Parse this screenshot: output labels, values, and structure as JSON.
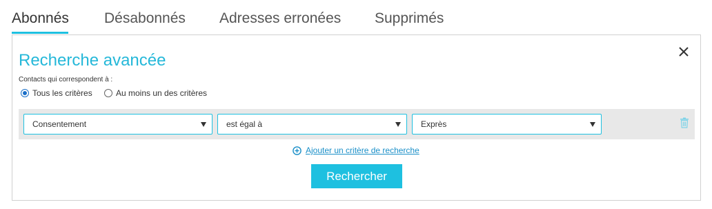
{
  "tabs": [
    {
      "label": "Abonnés",
      "active": true
    },
    {
      "label": "Désabonnés",
      "active": false
    },
    {
      "label": "Adresses erronées",
      "active": false
    },
    {
      "label": "Supprimés",
      "active": false
    }
  ],
  "search": {
    "title": "Recherche avancée",
    "match_label": "Contacts qui correspondent à :",
    "match_options": [
      {
        "label": "Tous les critères",
        "selected": true
      },
      {
        "label": "Au moins un des critères",
        "selected": false
      }
    ],
    "criteria": [
      {
        "field": "Consentement",
        "operator": "est égal à",
        "value": "Exprès"
      }
    ],
    "add_criterion_label": "Ajouter un critère de recherche",
    "submit_label": "Rechercher"
  },
  "icons": {
    "close": "close-icon",
    "delete": "trash-icon",
    "add": "plus-circle-icon"
  },
  "colors": {
    "accent": "#1ec0e0",
    "title": "#25b8d9",
    "link": "#1a8fc8",
    "row_background": "#e8e8e8"
  }
}
